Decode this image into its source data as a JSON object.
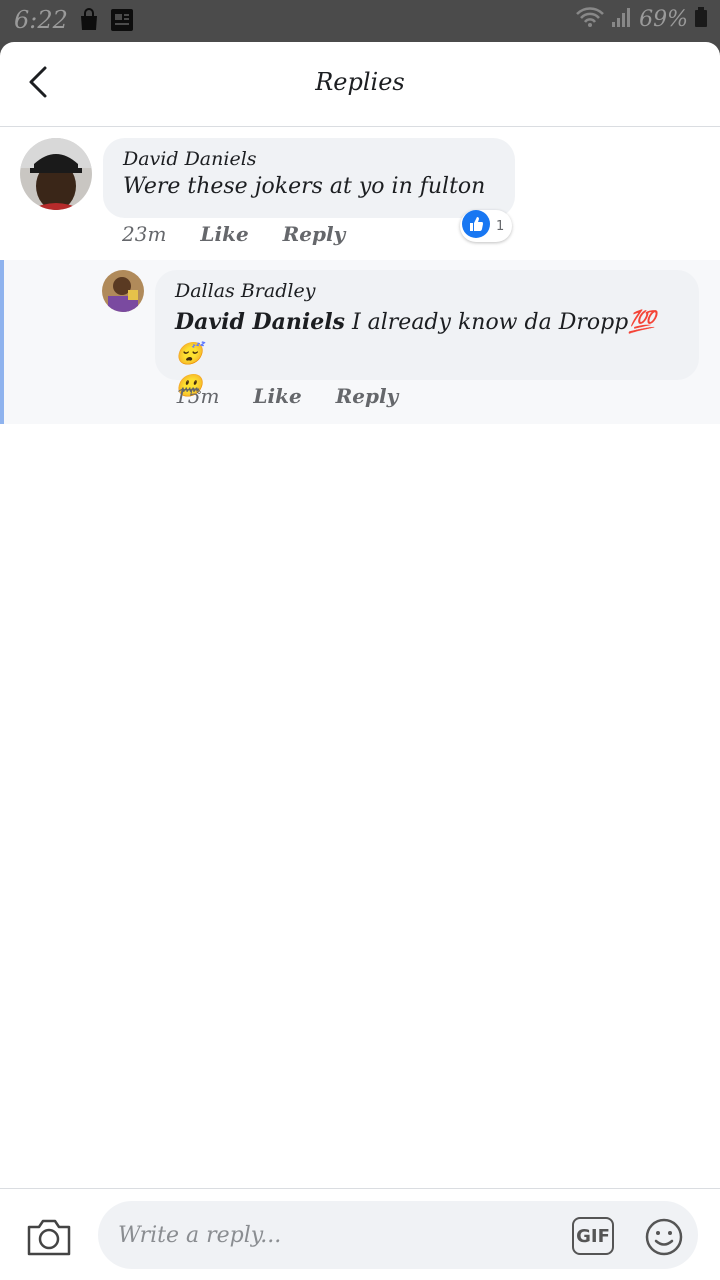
{
  "status_bar": {
    "time": "6:22",
    "battery": "69%"
  },
  "header": {
    "title": "Replies"
  },
  "comment": {
    "author": "David Daniels",
    "text": "Were these jokers at yo in fulton",
    "time": "23m",
    "like_label": "Like",
    "reply_label": "Reply",
    "reaction_count": "1"
  },
  "reply": {
    "author": "Dallas Bradley",
    "mention": "David Daniels",
    "text": " I already know da Dropp💯😴",
    "text2": "🤐",
    "time": "15m",
    "like_label": "Like",
    "reply_label": "Reply"
  },
  "composer": {
    "placeholder": "Write a reply...",
    "gif_label": "GIF"
  },
  "icons": {
    "back": "chevron-left-icon",
    "camera": "camera-icon",
    "emoji": "smiley-icon",
    "like_reaction": "thumbs-up-icon"
  },
  "colors": {
    "accent": "#1877f2",
    "bubble": "#f0f2f5",
    "reply_highlight": "#8fb3ee"
  }
}
